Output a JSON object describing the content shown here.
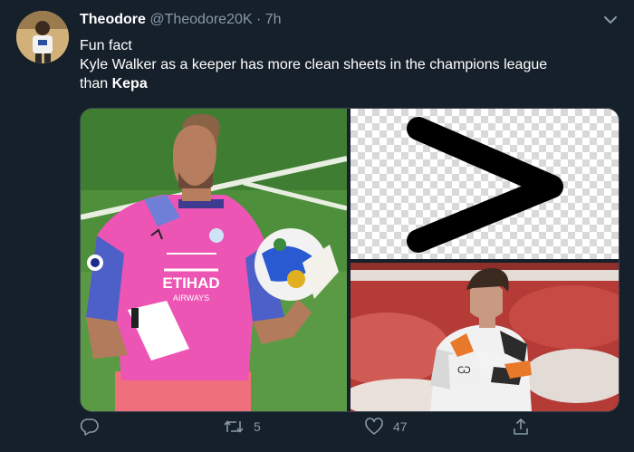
{
  "tweet": {
    "display_name": "Theodore",
    "handle": "@Theodore20K",
    "separator": "·",
    "time": "7h",
    "text_line1": "Fun fact",
    "text_line2": "Kyle Walker as a keeper has more clean sheets in the champions league",
    "text_line3_prefix": "than ",
    "text_line3_bold": "Kepa"
  },
  "media": {
    "left_image": "Kyle Walker in pink goalkeeper kit holding ball",
    "top_right_image": "greater-than symbol on transparent checkerboard",
    "bottom_right_image": "Kepa in white goalkeeper kit"
  },
  "shirt": {
    "sponsor_line1": "ETIHAD",
    "sponsor_line2": "AIRWAYS"
  },
  "actions": {
    "reply_count": "",
    "retweet_count": "5",
    "like_count": "47",
    "share_count": ""
  },
  "colors": {
    "background": "#15202b",
    "secondary_text": "#8899a6",
    "border": "#38444d"
  },
  "icons": [
    "caret-down-icon",
    "reply-icon",
    "retweet-icon",
    "like-icon",
    "share-icon"
  ]
}
